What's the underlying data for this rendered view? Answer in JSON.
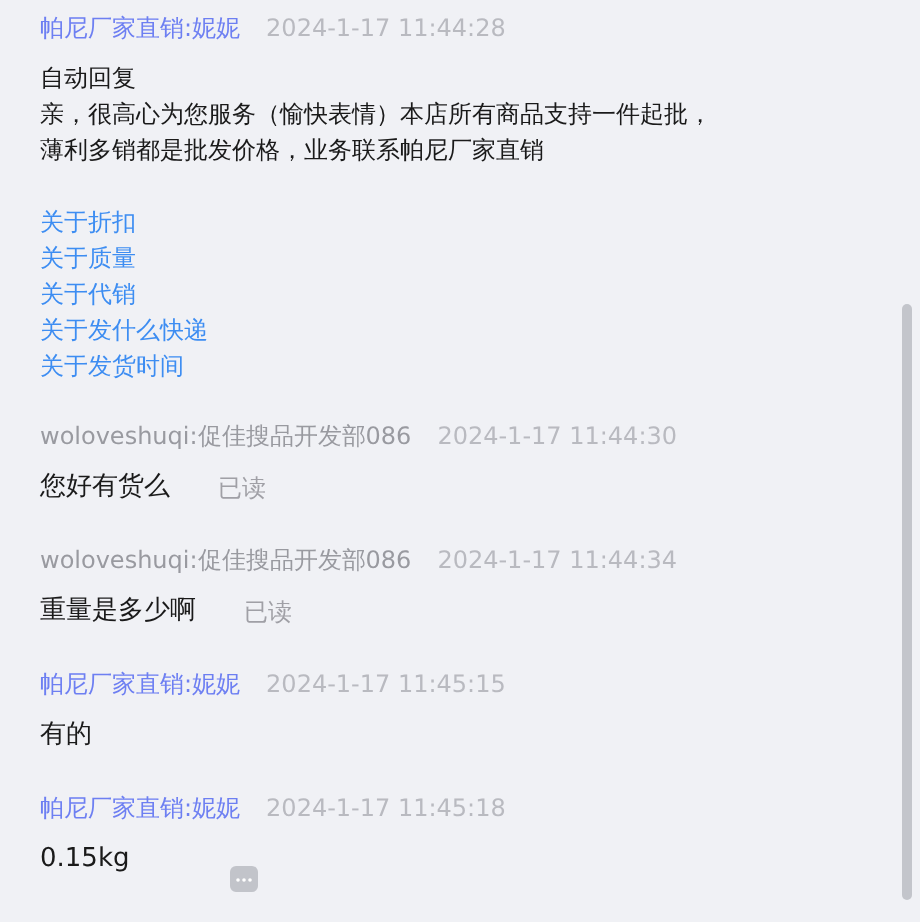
{
  "messages": [
    {
      "sender": "帕尼厂家直销:妮妮",
      "kind": "seller",
      "time": "2024-1-17 11:44:28",
      "lines": [
        "自动回复",
        "亲，很高心为您服务（愉快表情）本店所有商品支持一件起批，",
        "薄利多销都是批发价格，业务联系帕尼厂家直销"
      ],
      "links": [
        "关于折扣",
        "关于质量",
        "关于代销",
        "关于发什么快递",
        "关于发货时间"
      ]
    },
    {
      "sender": "woloveshuqi:促佳搜品开发部086",
      "kind": "buyer",
      "time": "2024-1-17 11:44:30",
      "lines": [
        "您好有货么"
      ],
      "status": "已读"
    },
    {
      "sender": "woloveshuqi:促佳搜品开发部086",
      "kind": "buyer",
      "time": "2024-1-17 11:44:34",
      "lines": [
        "重量是多少啊"
      ],
      "status": "已读"
    },
    {
      "sender": "帕尼厂家直销:妮妮",
      "kind": "seller",
      "time": "2024-1-17 11:45:15",
      "lines": [
        "有的"
      ]
    },
    {
      "sender": "帕尼厂家直销:妮妮",
      "kind": "seller",
      "time": "2024-1-17 11:45:18",
      "lines": [
        "0.15kg"
      ],
      "more_menu": true
    }
  ]
}
